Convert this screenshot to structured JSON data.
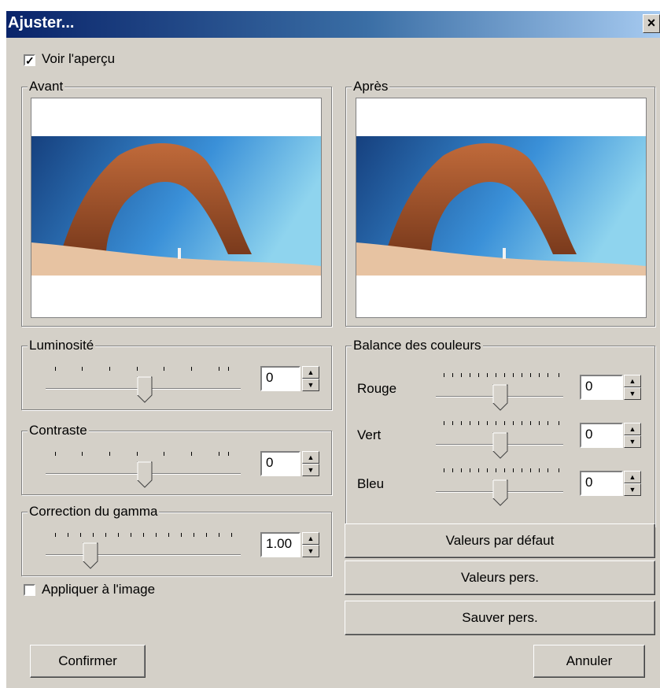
{
  "window": {
    "title": "Ajuster...",
    "close_glyph": "×"
  },
  "preview_toggle": {
    "label": "Voir l'aperçu",
    "checked": true
  },
  "before": {
    "label": "Avant"
  },
  "after": {
    "label": "Après"
  },
  "brightness": {
    "label": "Luminosité",
    "value": "0"
  },
  "contrast": {
    "label": "Contraste",
    "value": "0"
  },
  "gamma": {
    "label": "Correction du gamma",
    "value": "1.00"
  },
  "color_balance": {
    "label": "Balance des couleurs",
    "red": {
      "label": "Rouge",
      "value": "0"
    },
    "green": {
      "label": "Vert",
      "value": "0"
    },
    "blue": {
      "label": "Bleu",
      "value": "0"
    }
  },
  "buttons": {
    "defaults": "Valeurs par défaut",
    "custom": "Valeurs pers.",
    "save_custom": "Sauver pers.",
    "confirm": "Confirmer",
    "cancel": "Annuler"
  },
  "apply_to_image": {
    "label": "Appliquer à l'image",
    "checked": false
  },
  "spin_glyphs": {
    "up": "▲",
    "down": "▼"
  },
  "icons": [
    "checkbox-check-icon",
    "close-icon",
    "spin-up-icon",
    "spin-down-icon"
  ]
}
